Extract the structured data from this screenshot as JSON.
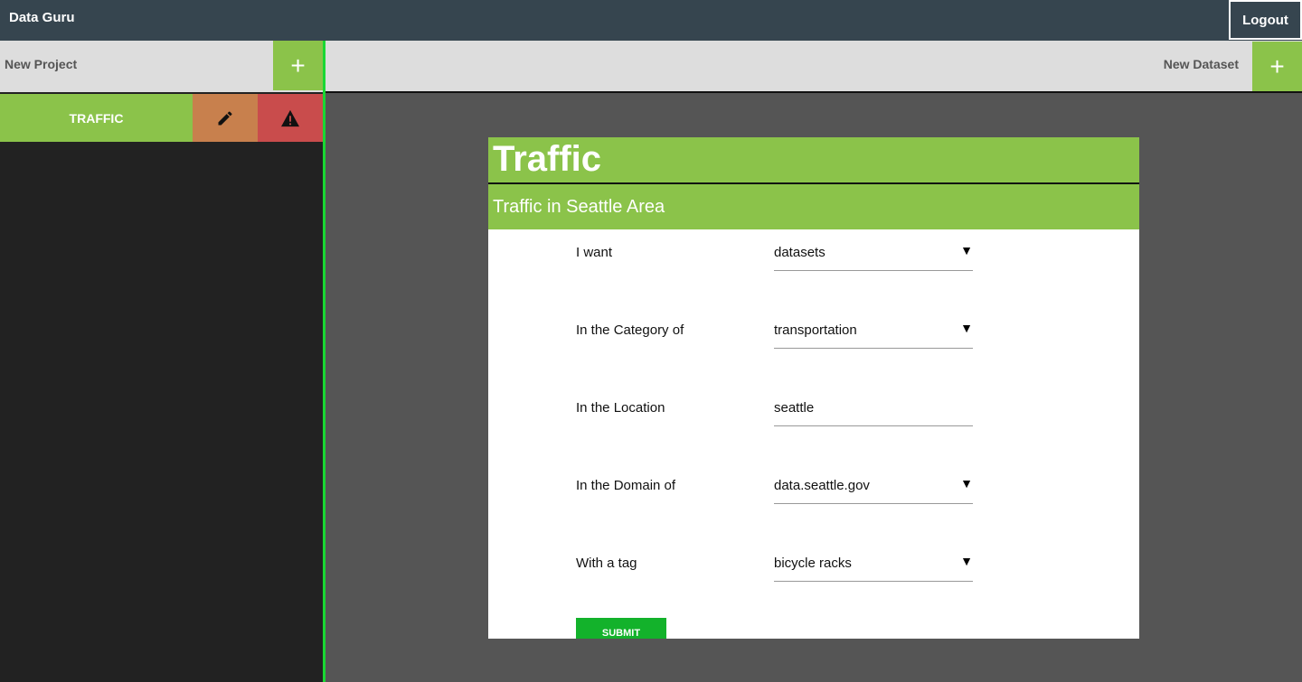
{
  "app": {
    "title": "Data Guru",
    "logout_label": "Logout"
  },
  "sidebar": {
    "new_project_label": "New Project",
    "projects": [
      {
        "name": "TRAFFIC"
      }
    ]
  },
  "main": {
    "new_dataset_label": "New Dataset"
  },
  "card": {
    "title": "Traffic",
    "subtitle": "Traffic in Seattle Area",
    "fields": [
      {
        "label": "I want",
        "value": "datasets",
        "dropdown": true
      },
      {
        "label": "In the Category of",
        "value": "transportation",
        "dropdown": true
      },
      {
        "label": "In the Location",
        "value": "seattle",
        "dropdown": false
      },
      {
        "label": "In the Domain of",
        "value": "data.seattle.gov",
        "dropdown": true
      },
      {
        "label": "With a tag",
        "value": "bicycle racks",
        "dropdown": true
      }
    ],
    "submit_label": "SUBMIT"
  },
  "icons": {
    "add": "plus-icon",
    "edit": "pencil-icon",
    "delete": "warning-icon",
    "dropdown": "caret-down-icon"
  },
  "colors": {
    "topbar": "#36454f",
    "accent_green": "#8bc34a",
    "edit": "#c8804d",
    "warning": "#c94c4c",
    "divider": "#19d832",
    "submit": "#13b22b"
  }
}
